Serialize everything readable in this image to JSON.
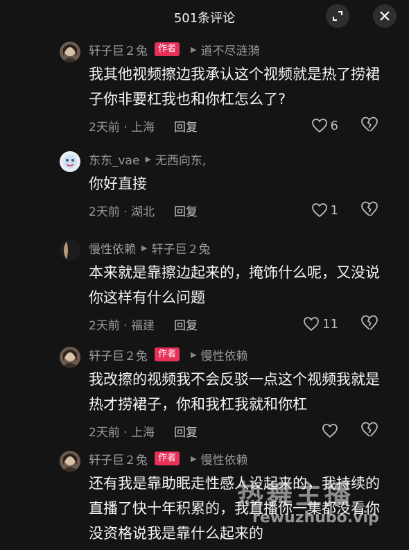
{
  "header": {
    "title": "501条评论"
  },
  "comments": [
    {
      "user": "轩子巨２兔",
      "tag": "作者",
      "reply_to": "道不尽涟漪",
      "text": "我其他视频擦边我承认这个视频就是热了捞裙子你非要杠我也和你杠怎么了?",
      "time_loc": "2天前 · 上海",
      "reply": "回复",
      "likes": "6"
    },
    {
      "user": "东东_vae",
      "reply_to": "无西向东,",
      "text": "你好直接",
      "time_loc": "2天前 · 湖北",
      "reply": "回复",
      "likes": "1"
    },
    {
      "user": "慢性依赖",
      "reply_to": "轩子巨２兔",
      "text": "本来就是靠擦边起来的，掩饰什么呢，又没说你这样有什么问题",
      "time_loc": "2天前 · 福建",
      "reply": "回复",
      "likes": "11"
    },
    {
      "user": "轩子巨２兔",
      "tag": "作者",
      "reply_to": "慢性依赖",
      "text": "我改擦的视频我不会反驳一点这个视频我就是热才捞裙子，你和我杠我就和你杠",
      "time_loc": "2天前 · 上海",
      "reply": "回复",
      "likes": ""
    },
    {
      "user": "轩子巨２兔",
      "tag": "作者",
      "reply_to": "慢性依赖",
      "text": "还有我是靠助眠走性感人设起来的，我持续的直播了快十年积累的，我直播你一集都没看你没资格说我是靠什么起来的"
    }
  ],
  "watermark": {
    "line1": "热舞主播",
    "line2": "rewuzhubo.vip"
  },
  "icons": {
    "expand": "expand-icon",
    "close": "close-icon",
    "like": "heart-outline-icon",
    "dislike": "broken-heart-icon",
    "arrow": "triangle-right-icon"
  },
  "colors": {
    "tag_bg": "#e8315a",
    "background": "#141414",
    "muted": "#9a9a9a"
  }
}
